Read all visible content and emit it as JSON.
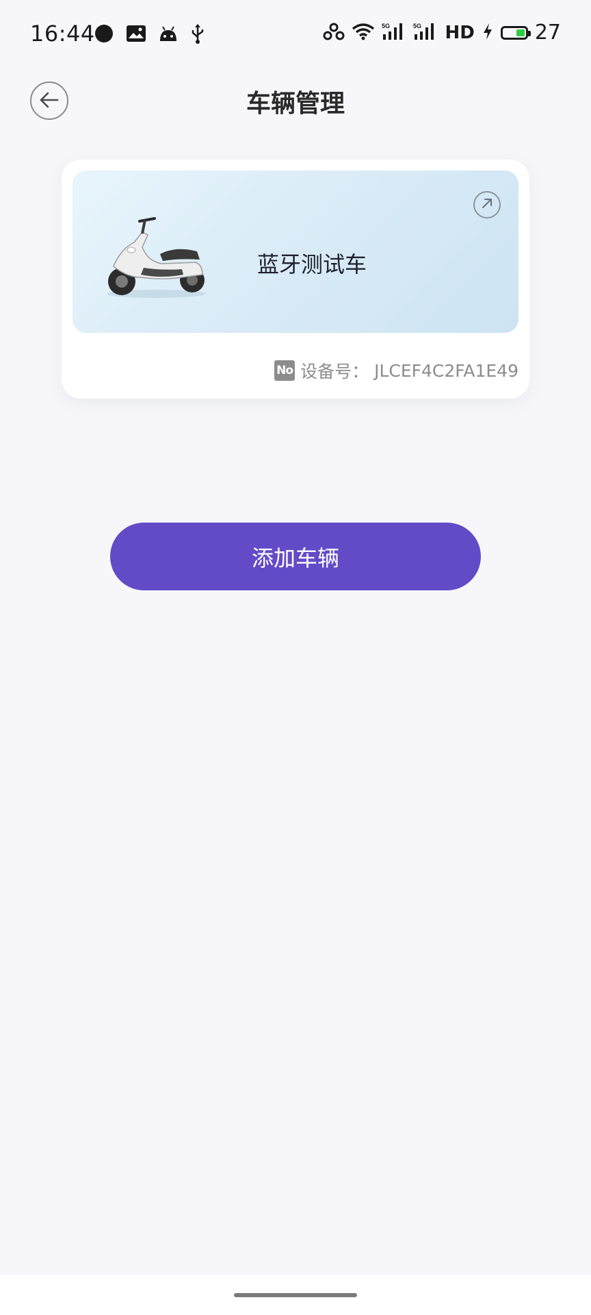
{
  "status_bar": {
    "time": "16:44",
    "hd_label": "HD",
    "battery_level": "27",
    "icons": [
      "message-bubble-icon",
      "gallery-icon",
      "android-icon",
      "usb-icon",
      "hotspot-icon",
      "wifi-icon",
      "signal-5g-icon",
      "signal-5g-icon",
      "charging-icon",
      "battery-icon"
    ],
    "battery_color": "#2ecc40"
  },
  "header": {
    "title": "车辆管理",
    "back_icon": "back-arrow-icon"
  },
  "vehicle_card": {
    "name": "蓝牙测试车",
    "device_label": "设备号：",
    "device_id": "JLCEF4C2FA1E49",
    "no_icon_text": "No",
    "image": "scooter-image",
    "detail_icon": "arrow-up-right-icon"
  },
  "actions": {
    "add_vehicle_label": "添加车辆"
  },
  "colors": {
    "accent": "#634bc8",
    "background": "#f7f7f9",
    "card_gradient_start": "#e8f5fc",
    "card_gradient_end": "#cde4f3"
  }
}
